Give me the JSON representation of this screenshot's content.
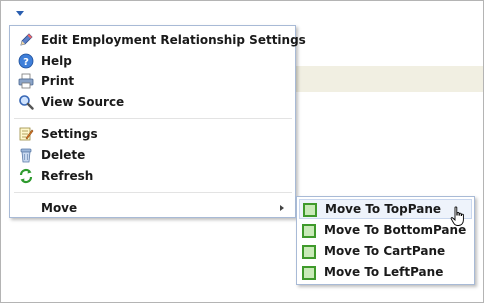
{
  "colors": {
    "accent": "#2a5fb0",
    "menu_border": "#a8bad6",
    "pane_green": "#3f9a2b",
    "tan_band": "#f1efe2"
  },
  "menu": {
    "items": [
      {
        "label": "Edit Employment Relationship Settings",
        "icon": "pencil-icon"
      },
      {
        "label": "Help",
        "icon": "help-icon"
      },
      {
        "label": "Print",
        "icon": "printer-icon"
      },
      {
        "label": "View Source",
        "icon": "magnifier-icon"
      },
      {
        "label": "Settings",
        "icon": "settings-notepad-icon"
      },
      {
        "label": "Delete",
        "icon": "trash-icon"
      },
      {
        "label": "Refresh",
        "icon": "refresh-icon"
      },
      {
        "label": "Move",
        "icon": ""
      }
    ]
  },
  "submenu": {
    "items": [
      {
        "label": "Move To TopPane",
        "icon": "pane-icon"
      },
      {
        "label": "Move To BottomPane",
        "icon": "pane-icon"
      },
      {
        "label": "Move To CartPane",
        "icon": "pane-icon"
      },
      {
        "label": "Move To LeftPane",
        "icon": "pane-icon"
      }
    ]
  }
}
